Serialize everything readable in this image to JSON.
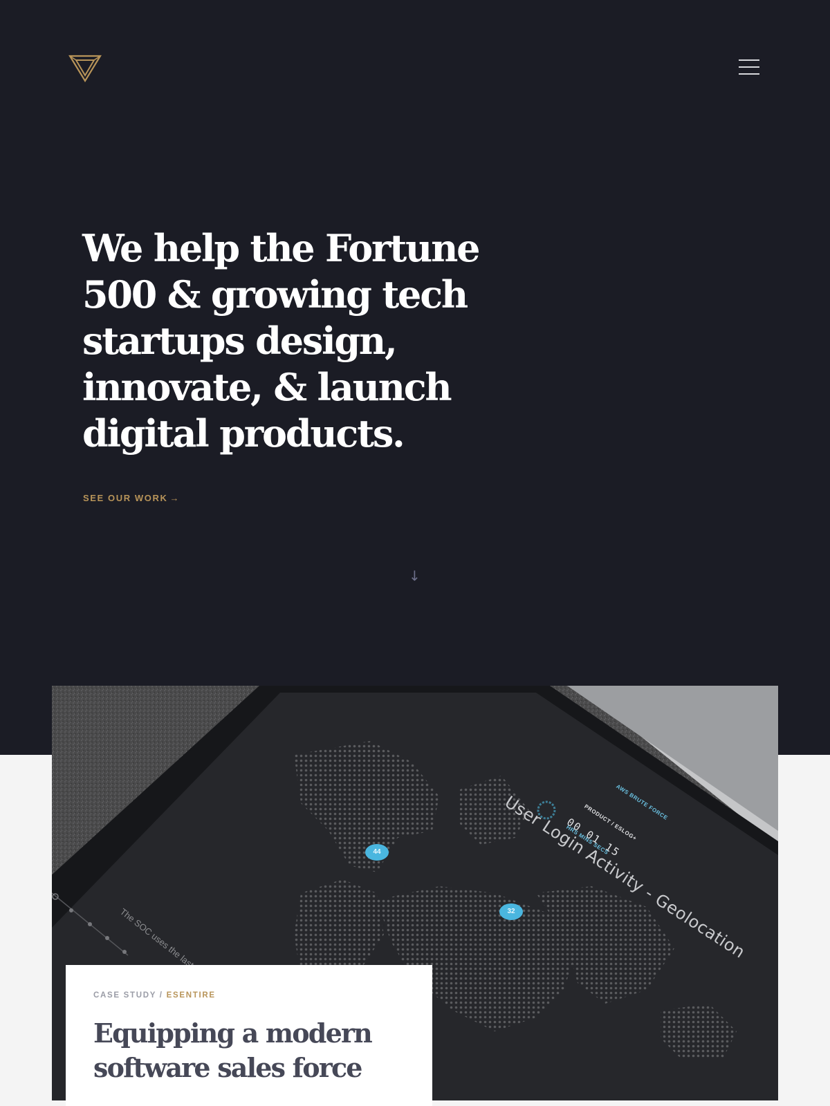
{
  "header": {
    "logo_icon": "triangle-logo-icon",
    "menu_icon": "hamburger-menu-icon"
  },
  "hero": {
    "headline": "We help the Fortune 500 & growing tech startups design, innovate, & launch digital products.",
    "cta_label": "SEE OUR WORK",
    "cta_arrow": "→",
    "scroll_arrow": "↓"
  },
  "case_study": {
    "image": {
      "title": "User Login Activity - Geolocation",
      "tag": "AWS BRUTE FORCE",
      "product": "PRODUCT / ESLOG+",
      "timer": "00 01 15",
      "timer_units": "HRS  MINS  SECS",
      "marker_1": "44",
      "marker_2": "32",
      "caption": "The SOC uses the last"
    },
    "label_prefix": "CASE STUDY /",
    "label_client": "ESENTIRE",
    "title": "Equipping a modern software sales force"
  },
  "colors": {
    "hero_bg": "#1b1c25",
    "page_bg": "#f4f4f4",
    "gold_accent": "#b89459",
    "card_title": "#464857",
    "map_marker": "#4ab6df"
  }
}
